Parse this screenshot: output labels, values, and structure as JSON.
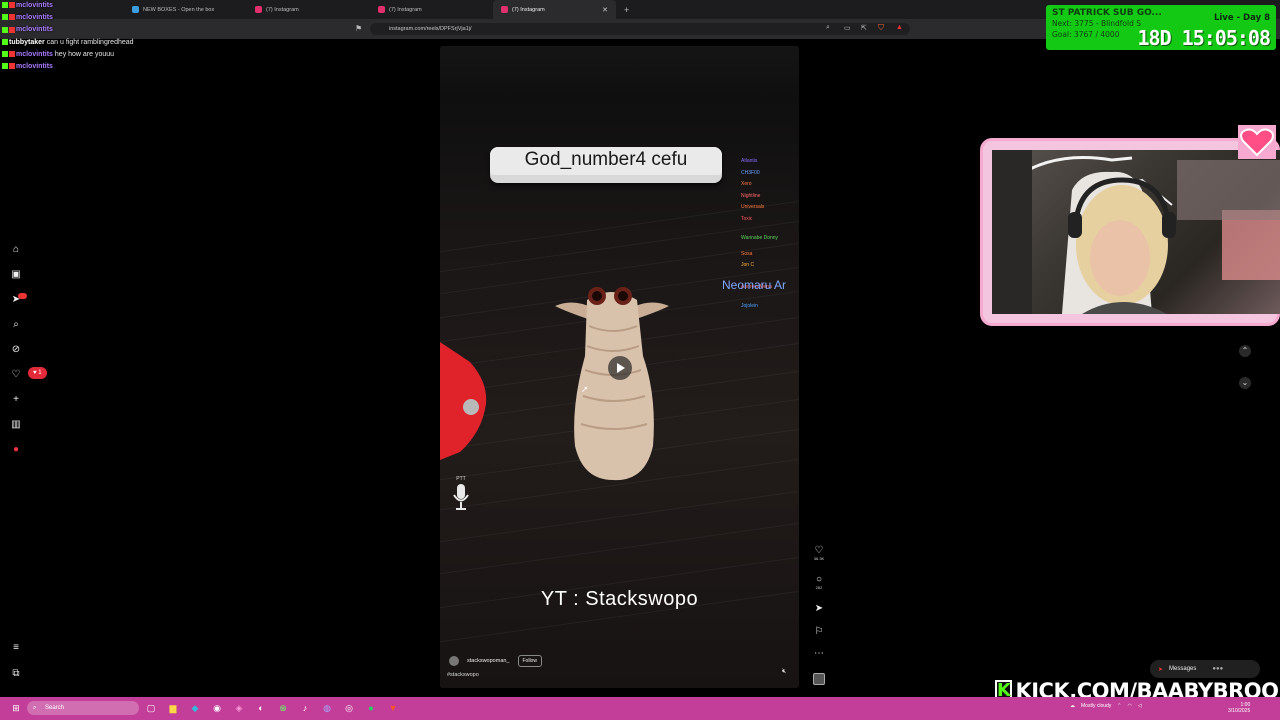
{
  "browser": {
    "tabs": [
      {
        "title": "NEW BOXES - Open the box",
        "color": "#3b9de0",
        "active": false
      },
      {
        "title": "(7) Instagram",
        "color": "#e1306c",
        "active": false
      },
      {
        "title": "(7) Instagram",
        "color": "#e1306c",
        "active": false
      },
      {
        "title": "(7) Instagram",
        "color": "#e1306c",
        "active": true
      }
    ],
    "url": "instagram.com/reels/DPFSrjVja1j/"
  },
  "chat": [
    {
      "user": "mclovintits",
      "msg": "",
      "color": "#a97bff"
    },
    {
      "user": "mclovintits",
      "msg": "",
      "color": "#a97bff"
    },
    {
      "user": "mclovintits",
      "msg": "",
      "color": "#a97bff"
    },
    {
      "user": "tubbytaker",
      "msg": "can u fight ramblingredhead",
      "color": "#ffffff"
    },
    {
      "user": "mclovintits",
      "msg": "hey how are youuu",
      "color": "#a97bff"
    },
    {
      "user": "mclovintits",
      "msg": "",
      "color": "#a97bff"
    }
  ],
  "reel": {
    "player_name": "God_number4 cefu",
    "side_name": "Neomaru Ar",
    "player_list": [
      {
        "name": "Atlantis",
        "color": "#8a6cff"
      },
      {
        "name": "CH3F00",
        "color": "#6aa0ff"
      },
      {
        "name": "Xero",
        "color": "#ff7a3a"
      },
      {
        "name": "Nightline",
        "color": "#ff6a6a"
      },
      {
        "name": "Universals",
        "color": "#ff7a3a"
      },
      {
        "name": "Toxic",
        "color": "#ff5a5a"
      },
      {
        "name": "Wannabe Donny",
        "color": "#5ad65a"
      },
      {
        "name": "Sosa",
        "color": "#ff7a3a"
      },
      {
        "name": "Jon C",
        "color": "#ffb347"
      },
      {
        "name": "Andrew Mena",
        "color": "#ff6a6a"
      },
      {
        "name": "Jojolein",
        "color": "#4aa0ff"
      }
    ],
    "caption_overlay": "YT : Stackswopo",
    "mic_label": "PTT",
    "author": "stackswopoman_",
    "follow_label": "Follow",
    "hashtag": "#stackswopo",
    "likes": "36.3K",
    "comments": "262"
  },
  "subathon": {
    "title": "ST PATRICK SUB GO...",
    "day": "Live - Day 8",
    "next": "Next: 3775 - Blindfold S",
    "goal": "Goal: 3767 / 4000",
    "timer": "18D 15:05:08",
    "color": "#14c914"
  },
  "messages_label": "Messages",
  "kick_label": "KICK.COM/BAABYBROOK",
  "notification_count": "1",
  "taskbar": {
    "search_placeholder": "Search",
    "weather": "Mostly cloudy",
    "time": "1:00",
    "date": "3/10/2025",
    "color": "#c23e98"
  }
}
